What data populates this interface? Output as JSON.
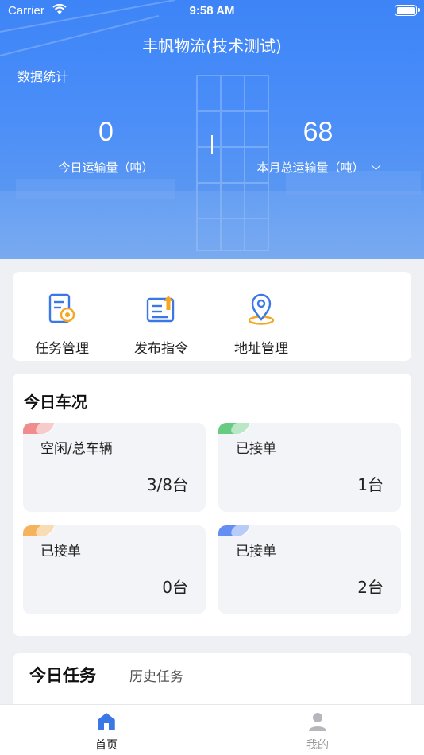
{
  "status_bar": {
    "carrier": "Carrier",
    "time": "9:58 AM"
  },
  "header": {
    "title": "丰帆物流(技术测试)",
    "section_label": "数据统计",
    "stats": [
      {
        "value": "0",
        "label": "今日运输量（吨）"
      },
      {
        "value": "68",
        "label": "本月总运输量（吨）"
      }
    ]
  },
  "quick_actions": [
    {
      "label": "任务管理",
      "icon": "task-doc-icon"
    },
    {
      "label": "发布指令",
      "icon": "publish-icon"
    },
    {
      "label": "地址管理",
      "icon": "location-pin-icon"
    }
  ],
  "vehicles": {
    "title": "今日车况",
    "items": [
      {
        "name": "空闲/总车辆",
        "value": "3/8台",
        "color": "#f07a7a"
      },
      {
        "name": "已接单",
        "value": "1台",
        "color": "#4fc36e"
      },
      {
        "name": "已接单",
        "value": "0台",
        "color": "#f5a742"
      },
      {
        "name": "已接单",
        "value": "2台",
        "color": "#4a7cf3"
      }
    ]
  },
  "tasks": {
    "tabs": [
      "今日任务",
      "历史任务"
    ]
  },
  "tabbar": {
    "items": [
      {
        "label": "首页",
        "icon": "home-icon",
        "active": true
      },
      {
        "label": "我的",
        "icon": "user-icon",
        "active": false
      }
    ]
  },
  "colors": {
    "primary": "#3d84f7",
    "background": "#eef0f4",
    "icon_blue": "#3b78e7",
    "icon_orange": "#f5a623"
  }
}
